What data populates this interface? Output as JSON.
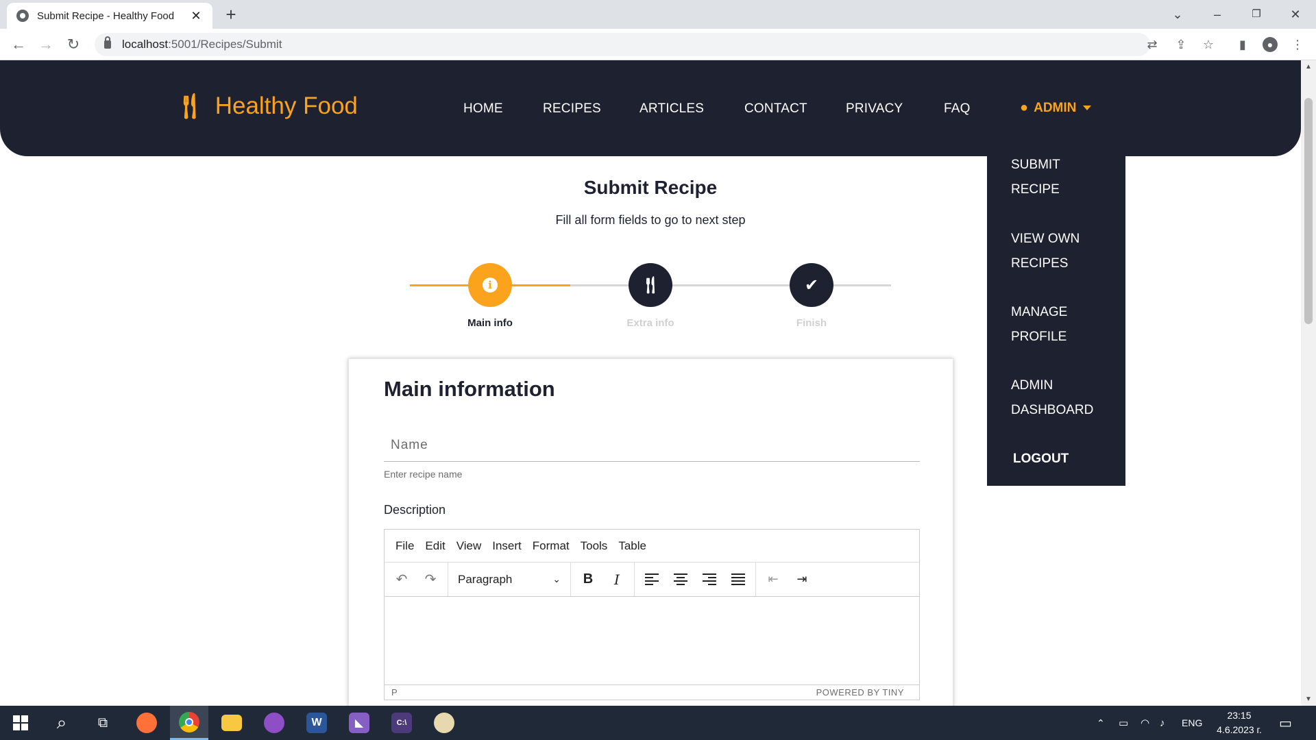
{
  "browser": {
    "tab_title": "Submit Recipe - Healthy Food",
    "url_host": "localhost",
    "url_rest": ":5001/Recipes/Submit"
  },
  "site": {
    "logo_text": "Healthy Food",
    "nav": {
      "home": "HOME",
      "recipes": "RECIPES",
      "articles": "ARTICLES",
      "contact": "CONTACT",
      "privacy": "PRIVACY",
      "faq": "FAQ",
      "admin": "ADMIN"
    },
    "dropdown": {
      "submit_1": "SUBMIT",
      "submit_2": "RECIPE",
      "view_1": "VIEW OWN",
      "view_2": "RECIPES",
      "manage_1": "MANAGE",
      "manage_2": "PROFILE",
      "admin_1": "ADMIN",
      "admin_2": "DASHBOARD",
      "logout": "LOGOUT"
    },
    "accent_color": "#fba31c",
    "dark_color": "#1e2130"
  },
  "page": {
    "title": "Submit Recipe",
    "subtitle": "Fill all form fields to go to next step",
    "steps": [
      {
        "label": "Main info",
        "state": "active",
        "icon": "info-icon"
      },
      {
        "label": "Extra info",
        "state": "pending",
        "icon": "utensils-icon"
      },
      {
        "label": "Finish",
        "state": "pending",
        "icon": "check-icon"
      }
    ]
  },
  "form": {
    "section_title": "Main information",
    "name_placeholder": "Name",
    "name_help": "Enter recipe name",
    "description_label": "Description"
  },
  "editor": {
    "menus": [
      "File",
      "Edit",
      "View",
      "Insert",
      "Format",
      "Tools",
      "Table"
    ],
    "block_format": "Paragraph",
    "status_path": "P",
    "powered_by": "POWERED BY TINY"
  },
  "taskbar": {
    "language": "ENG",
    "time": "23:15",
    "date": "4.6.2023 г."
  }
}
